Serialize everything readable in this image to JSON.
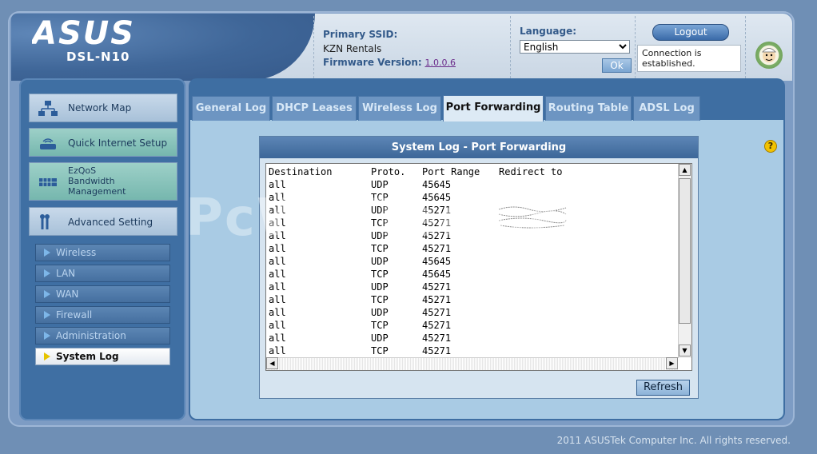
{
  "brand": {
    "model": "DSL-N10"
  },
  "header": {
    "ssid_label": "Primary SSID:",
    "ssid_value": "KZN Rentals",
    "firmware_label": "Firmware Version:",
    "firmware_value": "1.0.0.6",
    "language_label": "Language:",
    "language_selected": "English",
    "ok_label": "Ok",
    "logout_label": "Logout",
    "status_text": "Connection is established."
  },
  "sidebar": {
    "main_items": [
      {
        "label": "Network Map",
        "icon": "network-map-icon"
      },
      {
        "label": "Quick Internet Setup",
        "icon": "quick-setup-icon"
      },
      {
        "label": "EzQoS Bandwidth Management",
        "label_lines": [
          "EzQoS",
          "Bandwidth",
          "Management"
        ],
        "icon": "ezqos-icon"
      },
      {
        "label": "Advanced Setting",
        "icon": "wrench-icon"
      }
    ],
    "sub_items": [
      {
        "label": "Wireless",
        "active": false
      },
      {
        "label": "LAN",
        "active": false
      },
      {
        "label": "WAN",
        "active": false
      },
      {
        "label": "Firewall",
        "active": false
      },
      {
        "label": "Administration",
        "active": false
      },
      {
        "label": "System Log",
        "active": true
      }
    ]
  },
  "tabs": [
    {
      "label": "General Log",
      "active": false
    },
    {
      "label": "DHCP Leases",
      "active": false
    },
    {
      "label": "Wireless Log",
      "active": false
    },
    {
      "label": "Port Forwarding",
      "active": true
    },
    {
      "label": "Routing Table",
      "active": false
    },
    {
      "label": "ADSL Log",
      "active": false
    }
  ],
  "log": {
    "title": "System Log - Port Forwarding",
    "columns": [
      "Destination",
      "Proto.",
      "Port Range",
      "Redirect to"
    ],
    "rows": [
      [
        "all",
        "UDP",
        "45645",
        ""
      ],
      [
        "all",
        "TCP",
        "45645",
        ""
      ],
      [
        "all",
        "UDP",
        "45271",
        ""
      ],
      [
        "all",
        "TCP",
        "45271",
        ""
      ],
      [
        "all",
        "UDP",
        "45271",
        ""
      ],
      [
        "all",
        "TCP",
        "45271",
        ""
      ],
      [
        "all",
        "UDP",
        "45645",
        ""
      ],
      [
        "all",
        "TCP",
        "45645",
        ""
      ],
      [
        "all",
        "UDP",
        "45271",
        ""
      ],
      [
        "all",
        "TCP",
        "45271",
        ""
      ],
      [
        "all",
        "UDP",
        "45271",
        ""
      ],
      [
        "all",
        "TCP",
        "45271",
        ""
      ],
      [
        "all",
        "UDP",
        "45271",
        ""
      ],
      [
        "all",
        "TCP",
        "45271",
        ""
      ]
    ],
    "refresh_label": "Refresh"
  },
  "watermark": "PcWinTech.com",
  "footer": "2011 ASUSTek Computer Inc. All rights reserved.",
  "colors": {
    "accent": "#3f6fa3",
    "panel": "#a9cbe4",
    "active_arrow": "#e6c400"
  }
}
